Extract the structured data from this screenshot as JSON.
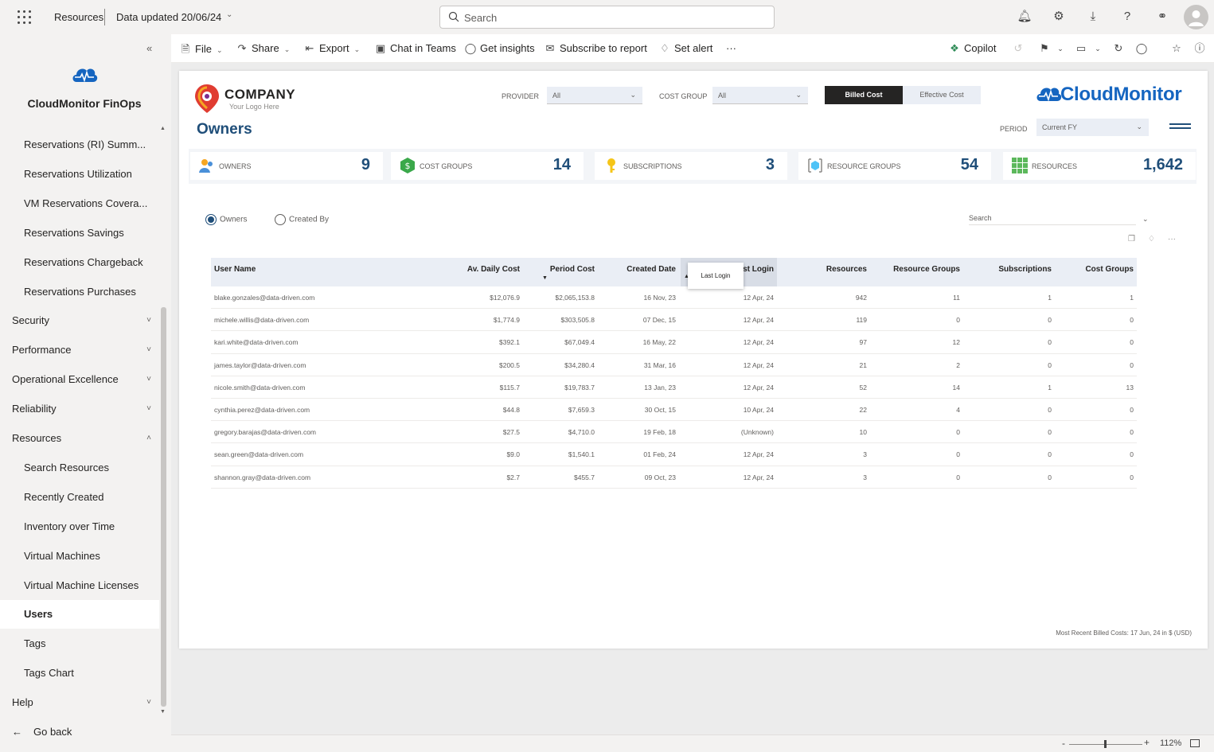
{
  "topbar": {
    "breadcrumb": "Resources",
    "data_updated": "Data updated 20/06/24",
    "search_placeholder": "Search"
  },
  "sidebar": {
    "title": "CloudMonitor FinOps",
    "items": [
      {
        "label": "Reservations (RI) Summ...",
        "type": "sub"
      },
      {
        "label": "Reservations Utilization",
        "type": "sub"
      },
      {
        "label": "VM Reservations Covera...",
        "type": "sub"
      },
      {
        "label": "Reservations Savings",
        "type": "sub"
      },
      {
        "label": "Reservations Chargeback",
        "type": "sub"
      },
      {
        "label": "Reservations Purchases",
        "type": "sub"
      },
      {
        "label": "Security",
        "type": "top"
      },
      {
        "label": "Performance",
        "type": "top"
      },
      {
        "label": "Operational Excellence",
        "type": "top"
      },
      {
        "label": "Reliability",
        "type": "top"
      },
      {
        "label": "Resources",
        "type": "top"
      },
      {
        "label": "Search Resources",
        "type": "sub"
      },
      {
        "label": "Recently Created",
        "type": "sub"
      },
      {
        "label": "Inventory over Time",
        "type": "sub"
      },
      {
        "label": "Virtual Machines",
        "type": "sub"
      },
      {
        "label": "Virtual Machine Licenses",
        "type": "sub"
      },
      {
        "label": "Users",
        "type": "sub",
        "active": true
      },
      {
        "label": "Tags",
        "type": "sub"
      },
      {
        "label": "Tags Chart",
        "type": "sub"
      },
      {
        "label": "Help",
        "type": "top"
      },
      {
        "label": "Go back",
        "type": "back"
      }
    ]
  },
  "actions": {
    "file": "File",
    "share": "Share",
    "export": "Export",
    "chat_in_teams": "Chat in Teams",
    "get_insights": "Get insights",
    "subscribe": "Subscribe to report",
    "set_alert": "Set alert",
    "more": "···",
    "copilot": "Copilot"
  },
  "report": {
    "company_name": "COMPANY",
    "company_tagline": "Your Logo Here",
    "page_title": "Owners",
    "filters": {
      "provider_label": "PROVIDER",
      "provider_value": "All",
      "cost_group_label": "COST GROUP",
      "cost_group_value": "All",
      "billed_cost": "Billed Cost",
      "effective_cost": "Effective Cost",
      "period_label": "PERIOD",
      "period_value": "Current FY"
    },
    "brand": "CloudMonitor",
    "kpis": [
      {
        "label": "OWNERS",
        "value": "9"
      },
      {
        "label": "COST GROUPS",
        "value": "14"
      },
      {
        "label": "SUBSCRIPTIONS",
        "value": "3"
      },
      {
        "label": "RESOURCE GROUPS",
        "value": "54"
      },
      {
        "label": "RESOURCES",
        "value": "1,642"
      }
    ],
    "radio": {
      "owners": "Owners",
      "created_by": "Created By"
    },
    "table_search": "Search",
    "tooltip": "Last Login",
    "columns": [
      "User Name",
      "Av. Daily Cost",
      "Period Cost",
      "Created Date",
      "Last Login",
      "Resources",
      "Resource Groups",
      "Subscriptions",
      "Cost Groups"
    ],
    "rows": [
      [
        "blake.gonzales@data-driven.com",
        "$12,076.9",
        "$2,065,153.8",
        "16 Nov, 23",
        "12 Apr, 24",
        "942",
        "11",
        "1",
        "1"
      ],
      [
        "michele.willis@data-driven.com",
        "$1,774.9",
        "$303,505.8",
        "07 Dec, 15",
        "12 Apr, 24",
        "119",
        "0",
        "0",
        "0"
      ],
      [
        "kari.white@data-driven.com",
        "$392.1",
        "$67,049.4",
        "16 May, 22",
        "12 Apr, 24",
        "97",
        "12",
        "0",
        "0"
      ],
      [
        "james.taylor@data-driven.com",
        "$200.5",
        "$34,280.4",
        "31 Mar, 16",
        "12 Apr, 24",
        "21",
        "2",
        "0",
        "0"
      ],
      [
        "nicole.smith@data-driven.com",
        "$115.7",
        "$19,783.7",
        "13 Jan, 23",
        "12 Apr, 24",
        "52",
        "14",
        "1",
        "13"
      ],
      [
        "cynthia.perez@data-driven.com",
        "$44.8",
        "$7,659.3",
        "30 Oct, 15",
        "10 Apr, 24",
        "22",
        "4",
        "0",
        "0"
      ],
      [
        "gregory.barajas@data-driven.com",
        "$27.5",
        "$4,710.0",
        "19 Feb, 18",
        "(Unknown)",
        "10",
        "0",
        "0",
        "0"
      ],
      [
        "sean.green@data-driven.com",
        "$9.0",
        "$1,540.1",
        "01 Feb, 24",
        "12 Apr, 24",
        "3",
        "0",
        "0",
        "0"
      ],
      [
        "shannon.gray@data-driven.com",
        "$2.7",
        "$455.7",
        "09 Oct, 23",
        "12 Apr, 24",
        "3",
        "0",
        "0",
        "0"
      ]
    ],
    "footnote": "Most Recent Billed Costs: 17 Jun, 24 in $ (USD)"
  },
  "statusbar": {
    "zoom": "112%",
    "zoom_level": 0.48
  },
  "colors": {
    "accent": "#1f4e79",
    "brand": "#1565c0",
    "active_toggle": "#252423"
  }
}
